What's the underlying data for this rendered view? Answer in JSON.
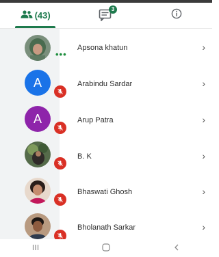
{
  "tabs": {
    "participants_count": "(43)",
    "chat_badge": "3"
  },
  "participants": [
    {
      "name": "Apsona khatun",
      "avatar": "photo",
      "status": "dots"
    },
    {
      "name": "Arabindu Sardar",
      "avatar": "letter",
      "initial": "A",
      "color": "#1a73e8",
      "status": "muted"
    },
    {
      "name": "Arup Patra",
      "avatar": "letter",
      "initial": "A",
      "color": "#8e24aa",
      "status": "muted"
    },
    {
      "name": "B. K",
      "avatar": "photo",
      "status": "muted"
    },
    {
      "name": "Bhaswati Ghosh",
      "avatar": "photo",
      "status": "muted"
    },
    {
      "name": "Bholanath Sarkar",
      "avatar": "photo",
      "status": "muted"
    }
  ],
  "icons": {
    "participants": "people-icon",
    "chat": "chat-icon",
    "info": "info-icon",
    "chevron": "chevron-right-icon",
    "mic_off": "mic-off-icon",
    "nav_recent": "recent-apps-icon",
    "nav_home": "home-icon",
    "nav_back": "back-icon"
  },
  "colors": {
    "accent": "#1e7a4d",
    "muted_badge": "#d93025",
    "avatar_col_bg": "#f1f3f4"
  }
}
